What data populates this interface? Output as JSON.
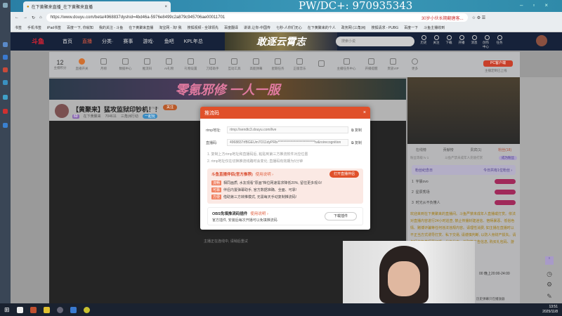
{
  "browser": {
    "tab_title": "在下黄聚来直播_在下黄聚来直播",
    "url": "https://www.douyu.com/beta/4968837dyshid=4bd46a-5976e8499c2a879c945706ae00011701",
    "search_hint": "30岁小伙长期翻唐客...",
    "watermark": "PW/DC+:  970935343",
    "bookmarks": [
      "书签",
      "手机书签",
      "iPad书签",
      "百度一下, 你就知",
      "我的关注 - 斗鱼",
      "在下黄聚来直播",
      "淘宝网 - 淘! 我",
      "搜狐视频 - 全球领先",
      "百度翻译",
      "讲讲,让你-中国传",
      "七秒-人你们无心",
      "在下黄聚来的个人",
      "政务网 (三角洲)",
      "搜狐请求 - PUBG",
      "百度一下",
      "斗鱼主播收到"
    ]
  },
  "header": {
    "nav": [
      "首页",
      "直播",
      "分类·",
      "赛事",
      "游戏·",
      "鱼吧",
      "KPL年总"
    ],
    "banner": "敢逐云霄志",
    "search_placeholder": "搜索小说",
    "icons": [
      "历史",
      "关注",
      "下载",
      "开播",
      "消息",
      "创作中心",
      "任务"
    ]
  },
  "toolbar": {
    "score": "12",
    "items": [
      "主播积分",
      "直播开关",
      "月榜",
      "数据中心",
      "推流码",
      "AI礼物",
      "礼物设置",
      "刀塔助手",
      "互动工具",
      "高能弹幕",
      "星期任务",
      "正版音乐",
      "",
      "主播任务中心",
      "开播提醒",
      "贵族VIP",
      "更多"
    ],
    "pc_button": "PC客户端",
    "pc_sub": "主播定制已上线"
  },
  "ad": {
    "text": "零氪邪修 一人一服"
  },
  "stream": {
    "title": "【黄聚来】猛攻监狱印钞机！！",
    "follow_count": "87616",
    "follow": "关注",
    "level": "60",
    "streamer": "在下黄聚来",
    "heat": "704611",
    "category": "三角洲行动",
    "tag": "一起玩",
    "player_message": "主播正在连线中, 请稍后重试"
  },
  "modal": {
    "title": "推流码",
    "rtmp_label": "rtmp地址:",
    "rtmp_value": "rtmp://sendtc3.douyu.com/live",
    "key_label": "直播码:",
    "key_value": "4968837rfBGEUm7O11dyPRlx***************************tv&roirecognition",
    "copy": "复制",
    "note1": "1. 复制上方rtmp地址和直播码后, 粘贴到第三方推流软件对应位置",
    "note2": "2. rtmp地址仅在切换推流线路时会变化; 直播码有效期为5分钟",
    "plugin_title": "斗鱼直播伴侣(官方推荐)",
    "usage": "使用说明 ›",
    "open_button": "打开直播伴侣",
    "features": [
      {
        "tag": "流畅",
        "text": "相同画质, 水友观看\"原画\"档位网速需求降低20%, 留住更多观众!"
      },
      {
        "tag": "可靠",
        "text": "伴侣内置弹幕助手, 官方数据准确、全面、可靠!"
      },
      {
        "tag": "方便",
        "text": "借助第三方转推模式, 无需每天手动复制推流码!"
      }
    ],
    "obs_title": "OBS免填推流码插件",
    "obs_desc": "官方插件, 安装后每次开播可以免填推流码",
    "download": "下载插件"
  },
  "right": {
    "tabs": [
      "在线榜",
      "贡献榜",
      "贵宾(1)",
      "粉丝(18)"
    ],
    "fan_level": "粉丝等级 lv 1",
    "fan_notice": "斗鱼严禁未成年人充值打赏",
    "fan_btn": "成为粉丝",
    "fan_day": "粉丝纪念日",
    "fan_day_link": "今日共有1位粉丝 ›",
    "fans": [
      {
        "rank": "1",
        "name": "宇晨ovo"
      },
      {
        "rank": "2",
        "name": "星辰秀场"
      },
      {
        "rank": "3",
        "name": "时光从不负懂人"
      }
    ],
    "welcome": "欢迎来到在下黄聚来的直播间。斗鱼严禁未成年人直播或打赏。依法对直播内容进行24小时巡查, 禁止传播封建迷信、宿柄暴恶、低俗色情、赌博诈骗等任何违法违规内容。请理性消费, 如主播在直播时以不正当方式诱导打赏、私下交易, 请谨慎判断, 以防人身财产损失。请勿轻信各类招募征婚、代练代充、兼职等广告信息, 购买礼包码、游戏道具等...",
    "schedule": "00 晚上20:00-24:00",
    "history": "历史弹幕只在播放器"
  },
  "taskbar": {
    "time": "13:51",
    "date": "2025/11/8"
  }
}
